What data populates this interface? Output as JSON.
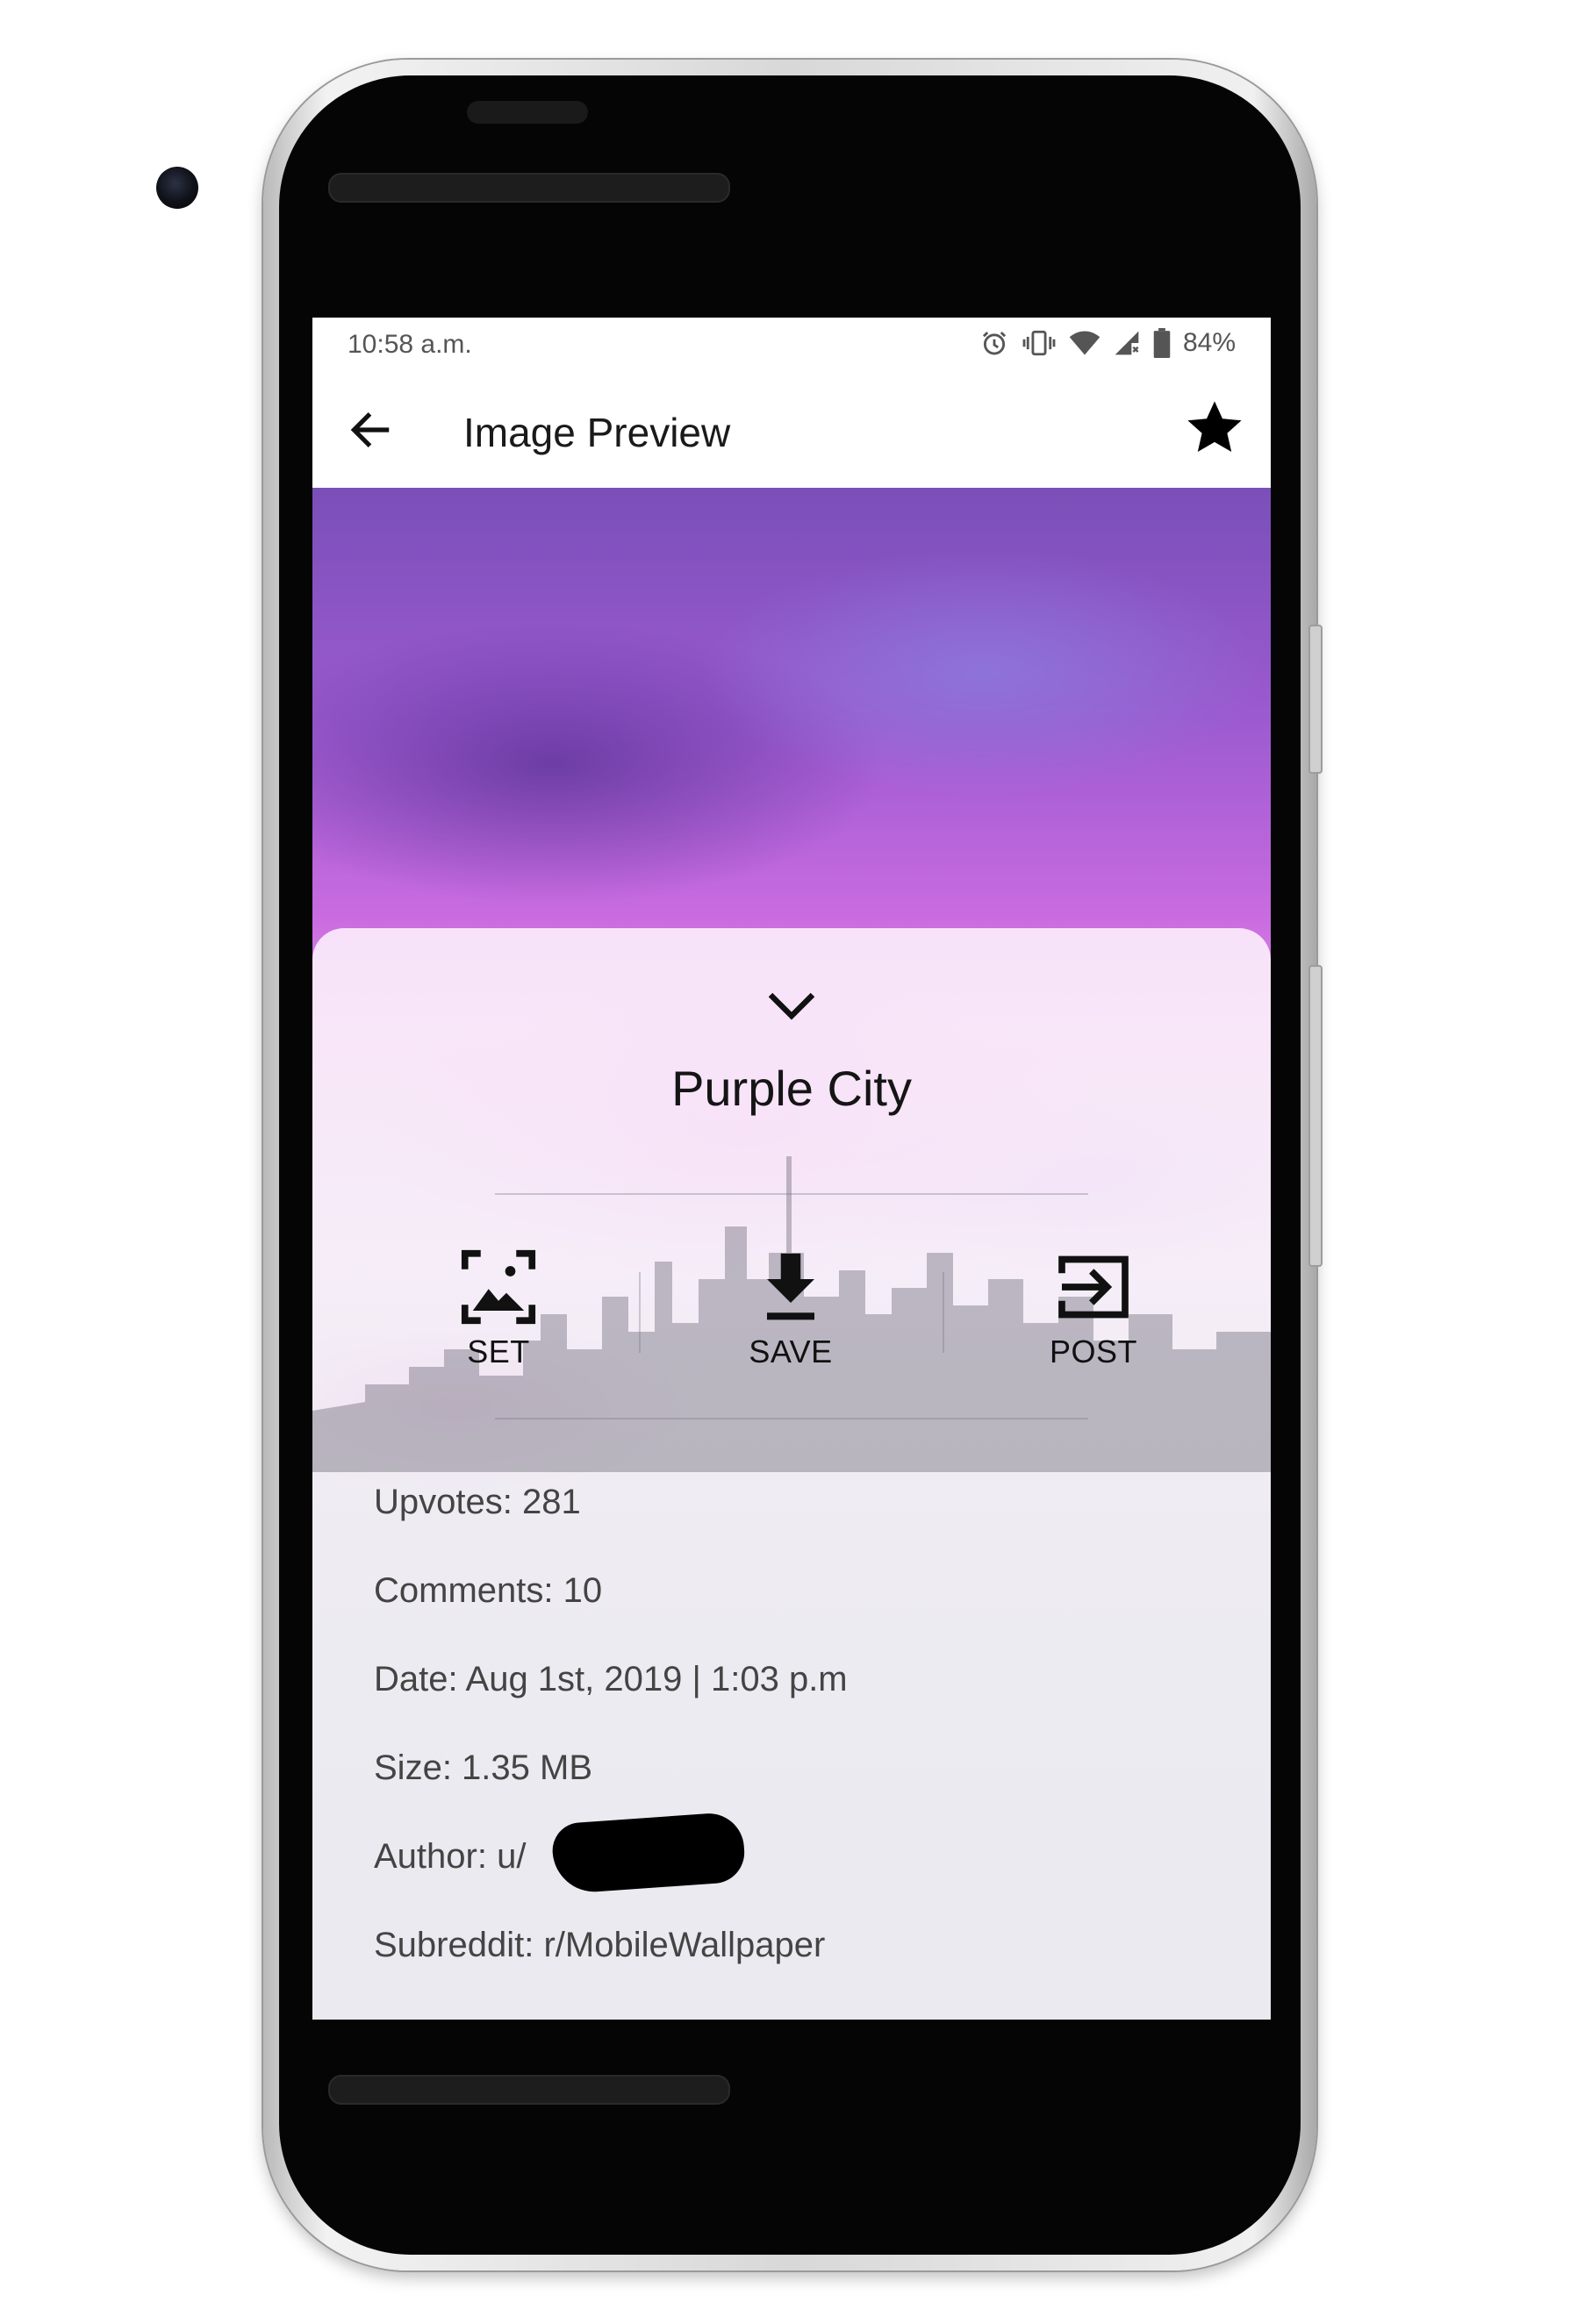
{
  "status_bar": {
    "time": "10:58 a.m.",
    "battery": "84%",
    "icons": [
      "alarm-icon",
      "vibrate-icon",
      "wifi-icon",
      "signal-icon",
      "battery-icon"
    ]
  },
  "app_bar": {
    "title": "Image Preview",
    "back_icon": "arrow-left-icon",
    "favorite_icon": "star-icon"
  },
  "sheet": {
    "collapse_icon": "chevron-down-icon",
    "title": "Purple City",
    "actions": [
      {
        "label": "SET",
        "icon": "set-wallpaper-icon"
      },
      {
        "label": "SAVE",
        "icon": "download-icon"
      },
      {
        "label": "POST",
        "icon": "exit-arrow-icon"
      }
    ],
    "info": {
      "upvotes": "Upvotes: 281",
      "comments": "Comments: 10",
      "date": "Date: Aug 1st, 2019 | 1:03 p.m",
      "size": "Size: 1.35 MB",
      "author": "Author: u/",
      "subreddit": "Subreddit: r/MobileWallpaper"
    }
  },
  "colors": {
    "text_primary": "#151515",
    "text_secondary": "#444444",
    "sky_purple": "#9c5ad0",
    "sky_magenta": "#e050d8"
  }
}
